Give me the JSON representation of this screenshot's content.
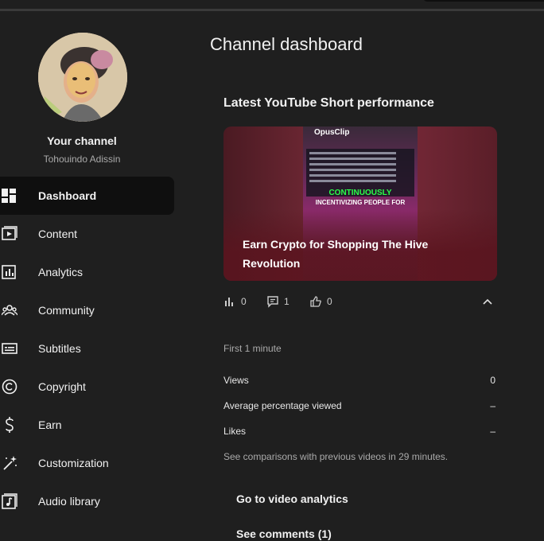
{
  "sidebar": {
    "channel_title": "Your channel",
    "channel_handle": "Tohouindo Adissin",
    "items": [
      {
        "label": "Dashboard",
        "icon": "dashboard-icon",
        "active": true
      },
      {
        "label": "Content",
        "icon": "content-icon"
      },
      {
        "label": "Analytics",
        "icon": "analytics-icon"
      },
      {
        "label": "Community",
        "icon": "community-icon"
      },
      {
        "label": "Subtitles",
        "icon": "subtitles-icon"
      },
      {
        "label": "Copyright",
        "icon": "copyright-icon"
      },
      {
        "label": "Earn",
        "icon": "earn-icon"
      },
      {
        "label": "Customization",
        "icon": "customization-icon"
      },
      {
        "label": "Audio library",
        "icon": "audio-library-icon"
      }
    ]
  },
  "main": {
    "page_title": "Channel dashboard",
    "card_title": "Latest YouTube Short performance",
    "short": {
      "title": "Earn Crypto for Shopping The Hive Revolution",
      "thumb_logo": "OpusClip",
      "thumb_banner_1": "CONTINUOUSLY",
      "thumb_banner_2": "INCENTIVIZING PEOPLE FOR",
      "views_count": "0",
      "comments_count": "1",
      "likes_count": "0"
    },
    "period_label": "First 1 minute",
    "metrics": [
      {
        "label": "Views",
        "value": "0"
      },
      {
        "label": "Average percentage viewed",
        "value": "–"
      },
      {
        "label": "Likes",
        "value": "–"
      }
    ],
    "comparison_note": "See comparisons with previous videos in 29 minutes.",
    "analytics_link": "Go to video analytics",
    "comments_link": "See comments (1)"
  },
  "colors": {
    "background": "#1f1f1f",
    "active_nav": "#0f0f0f",
    "text_primary": "#f1f1f1",
    "text_secondary": "#aaaaaa"
  }
}
